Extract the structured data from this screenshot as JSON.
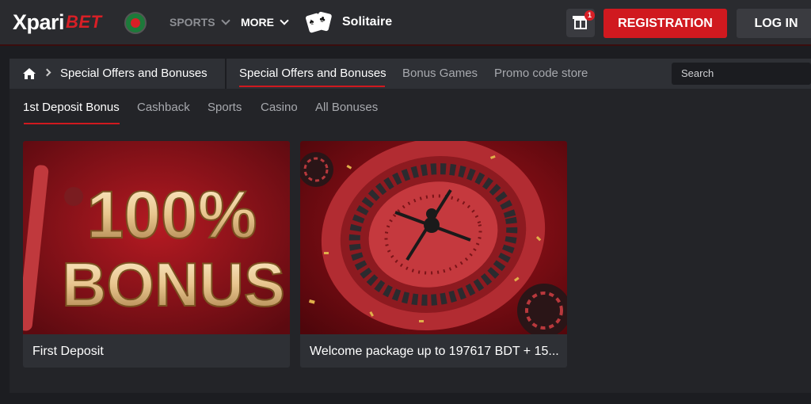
{
  "header": {
    "logo_main": "Xpari",
    "logo_accent": "BET",
    "nav": [
      {
        "label": "SPORTS"
      },
      {
        "label": "MORE"
      }
    ],
    "featured_game": "Solitaire",
    "gift_count": "1",
    "registration_label": "REGISTRATION",
    "login_label": "LOG IN"
  },
  "breadcrumb": {
    "current": "Special Offers and Bonuses"
  },
  "subnav": {
    "tabs": [
      {
        "label": "Special Offers and Bonuses",
        "active": true
      },
      {
        "label": "Bonus Games",
        "active": false
      },
      {
        "label": "Promo code store",
        "active": false
      }
    ],
    "search_placeholder": "Search"
  },
  "bonus_tabs": [
    {
      "label": "1st Deposit Bonus",
      "active": true
    },
    {
      "label": "Cashback",
      "active": false
    },
    {
      "label": "Sports",
      "active": false
    },
    {
      "label": "Casino",
      "active": false
    },
    {
      "label": "All Bonuses",
      "active": false
    }
  ],
  "promos": [
    {
      "title": "First Deposit",
      "art_text_top": "100%",
      "art_text_bottom": "BONUS"
    },
    {
      "title": "Welcome package up to 197617 BDT + 15..."
    }
  ],
  "colors": {
    "accent": "#d0191f",
    "topbar": "#2a2b2f",
    "background": "#1c1d21"
  }
}
